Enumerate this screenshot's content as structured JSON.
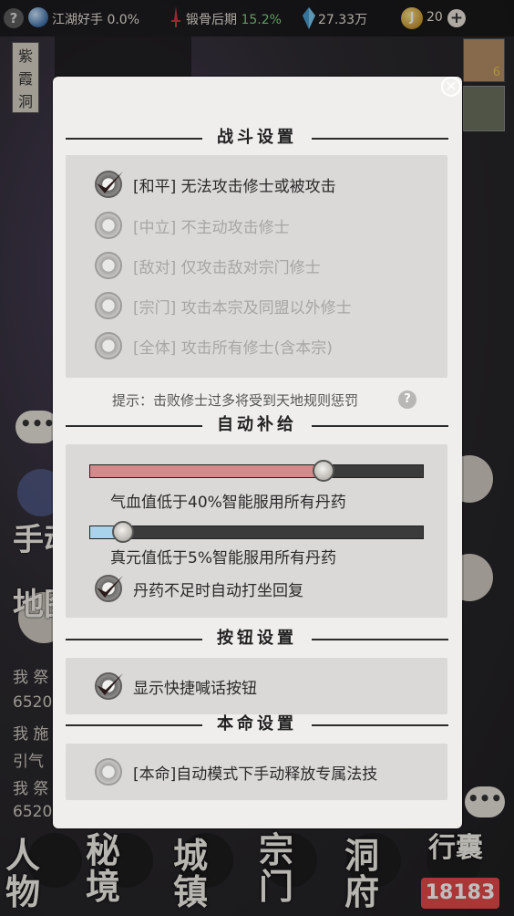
{
  "topbar": {
    "help": "?",
    "cultivation_title": "江湖好手",
    "cultivation_pct": "0.0%",
    "realm": "锻骨后期",
    "realm_pct": "15.2%",
    "spirit_stones": "27.33万",
    "coin_symbol": "J",
    "coins": "20",
    "plus": "+"
  },
  "location": "紫霞洞",
  "side": {
    "item_count": "6"
  },
  "chat_bubble_left": "•••",
  "chat_bubble_right": "•••",
  "bg_labels": {
    "manual": "手动",
    "map": "地图"
  },
  "chat_lines": [
    "我 祭",
    "6520",
    "我 施",
    "引气",
    "我 祭",
    "6520"
  ],
  "nav": [
    "人物",
    "秘境",
    "城镇",
    "宗门",
    "洞府",
    "行囊"
  ],
  "logo": "18183",
  "dialog": {
    "close": "✕",
    "battle": {
      "title": "战斗设置",
      "options": [
        {
          "label": "[和平] 无法攻击修士或被攻击",
          "selected": true
        },
        {
          "label": "[中立] 不主动攻击修士",
          "selected": false
        },
        {
          "label": "[敌对] 仅攻击敌对宗门修士",
          "selected": false
        },
        {
          "label": "[宗门] 攻击本宗及同盟以外修士",
          "selected": false
        },
        {
          "label": "[全体] 攻击所有修士(含本宗)",
          "selected": false
        }
      ],
      "hint": "提示：击败修士过多将受到天地规则惩罚",
      "hint_icon": "?"
    },
    "supply": {
      "title": "自动补给",
      "hp_threshold": 0.7,
      "hp_label": "气血值低于40%智能服用所有丹药",
      "mp_threshold": 0.1,
      "mp_label": "真元值低于5%智能服用所有丹药",
      "auto_meditate": {
        "label": "丹药不足时自动打坐回复",
        "checked": true
      },
      "hp_color": "#d48a8a",
      "mp_color": "#a9d3ea"
    },
    "buttons": {
      "title": "按钮设置",
      "quick_chat": {
        "label": "显示快捷喊话按钮",
        "checked": true
      }
    },
    "natal": {
      "title": "本命设置",
      "manual_skill": {
        "label": "[本命]自动模式下手动释放专属法技",
        "checked": false
      }
    }
  }
}
